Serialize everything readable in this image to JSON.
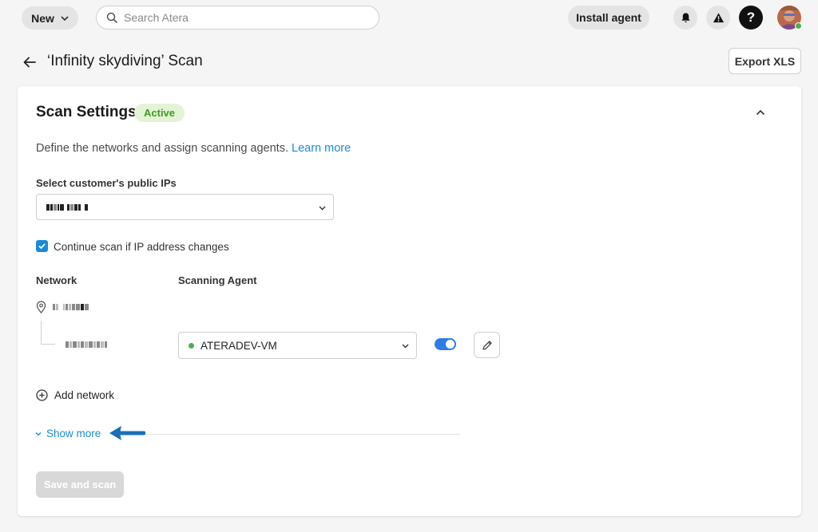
{
  "topbar": {
    "new_label": "New",
    "search_placeholder": "Search Atera",
    "install_agent_label": "Install agent"
  },
  "page": {
    "title": "‘Infinity skydiving’ Scan",
    "export_label": "Export XLS"
  },
  "scan_settings": {
    "title": "Scan Settings",
    "status": "Active",
    "description": "Define the networks and assign scanning agents.",
    "learn_more": "Learn more",
    "public_ips_label": "Select customer's public IPs",
    "continue_scan_label": "Continue scan if IP address changes",
    "continue_scan_checked": true,
    "network_header": "Network",
    "agent_header": "Scanning Agent",
    "agent_value": "ATERADEV-VM",
    "agent_status_color": "#4caf50",
    "agent_enabled": true,
    "add_network_label": "Add network",
    "show_more_label": "Show more",
    "save_label": "Save and scan"
  },
  "colors": {
    "accent": "#1a8bd6",
    "toggle": "#2b7de9",
    "active_badge_bg": "#e4f3d6",
    "active_badge_text": "#3d9b21"
  }
}
